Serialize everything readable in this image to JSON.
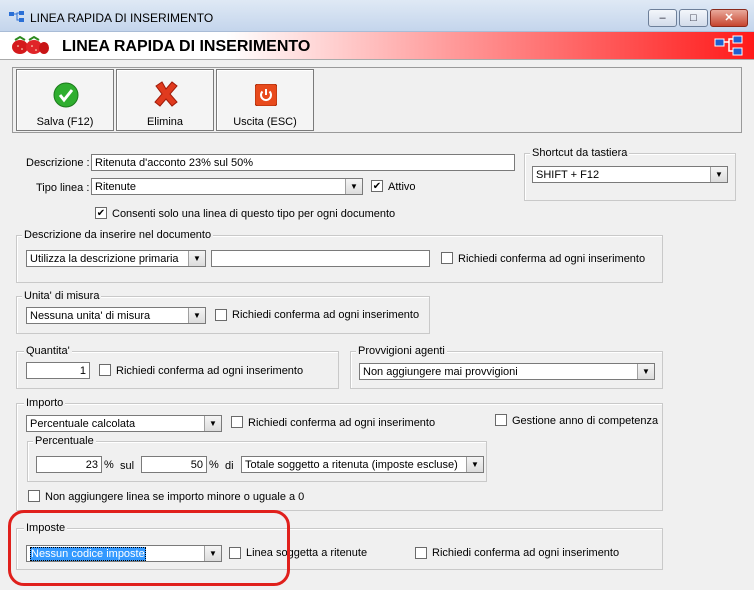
{
  "window": {
    "title": "LINEA RAPIDA DI INSERIMENTO",
    "minimize": "–",
    "maximize": "□",
    "close": "✕"
  },
  "banner": {
    "title": "LINEA RAPIDA DI INSERIMENTO",
    "logo_icon": "strawberry-icon",
    "right_icon": "network-icon"
  },
  "toolbar": {
    "save_label": "Salva (F12)",
    "delete_label": "Elimina",
    "exit_label": "Uscita (ESC)"
  },
  "form": {
    "descrizione_label": "Descrizione :",
    "descrizione_value": "Ritenuta d'acconto 23% sul 50%",
    "tipo_linea_label": "Tipo linea :",
    "tipo_linea_value": "Ritenute",
    "attivo_label": "Attivo",
    "consenti_label": "Consenti solo una linea di questo tipo per ogni documento",
    "shortcut_title": "Shortcut da tastiera",
    "shortcut_value": "SHIFT + F12"
  },
  "descrizione_doc": {
    "title": "Descrizione da inserire nel documento",
    "select_value": "Utilizza la descrizione primaria",
    "text_value": "",
    "confirm_label": "Richiedi conferma ad ogni inserimento"
  },
  "unita": {
    "title": "Unita' di misura",
    "select_value": "Nessuna unita' di misura",
    "confirm_label": "Richiedi conferma ad ogni inserimento"
  },
  "quantita": {
    "title": "Quantita'",
    "value": "1",
    "confirm_label": "Richiedi conferma ad ogni inserimento"
  },
  "provvigioni": {
    "title": "Provvigioni agenti",
    "select_value": "Non aggiungere mai provvigioni"
  },
  "importo": {
    "title": "Importo",
    "select_value": "Percentuale calcolata",
    "confirm_label": "Richiedi conferma ad ogni inserimento",
    "gestione_label": "Gestione anno di competenza",
    "percentuale_title": "Percentuale",
    "perc_value": "23",
    "perc_unit": "%",
    "sul_label": "sul",
    "base_value": "50",
    "base_unit": "%",
    "di_label": "di",
    "totale_value": "Totale soggetto a ritenuta (imposte escluse)",
    "non_aggiungere_label": "Non aggiungere linea se importo minore o uguale a 0"
  },
  "imposte": {
    "title": "Imposte",
    "select_value": "Nessun codice imposte",
    "ritenute_label": "Linea soggetta a ritenute",
    "confirm_label": "Richiedi conferma ad ogni inserimento"
  },
  "colors": {
    "accent_red": "#ff1a1a",
    "highlight": "#e0201c",
    "selection": "#3399ff"
  }
}
